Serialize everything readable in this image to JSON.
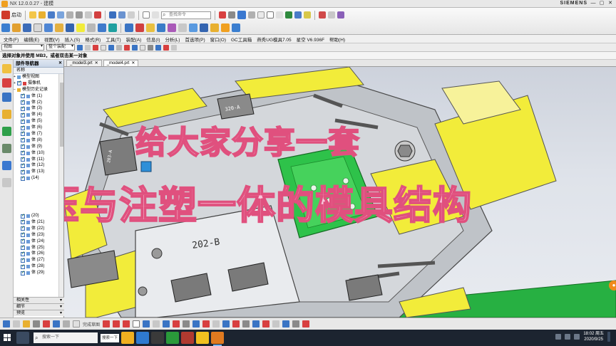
{
  "window": {
    "title": "NX 12.0.0.27 - 建模",
    "brand": "SIEMENS"
  },
  "ribbon": {
    "start_label": "启动",
    "command_search_placeholder": "查找命令"
  },
  "menu": [
    "文件(F)",
    "编辑(E)",
    "视图(V)",
    "插入(S)",
    "格式(R)",
    "工具(T)",
    "装配(A)",
    "信息(I)",
    "分析(L)",
    "首选项(P)",
    "窗口(O)",
    "GC工具箱",
    "燕秀UG模具7.05",
    "星空 V6.936F",
    "帮助(H)"
  ],
  "selection_bar": {
    "filter_value": "视图",
    "scope_value": "整个装配"
  },
  "hint": "选择对象并使用 MB3，或者双击某一对象",
  "navigator": {
    "title": "部件导航器",
    "column_name": "名称",
    "root_items": [
      "模型视图",
      "摄像机",
      "模型历史记录"
    ],
    "bodies": [
      "体 (1)",
      "体 (2)",
      "体 (3)",
      "体 (4)",
      "体 (5)",
      "体 (6)",
      "体 (7)",
      "体 (8)",
      "体 (9)",
      "体 (10)",
      "体 (11)",
      "体 (12)",
      "体 (13)",
      "(14)"
    ],
    "bodies_lower": [
      "(20)",
      "体 (21)",
      "体 (22)",
      "体 (23)",
      "体 (24)",
      "体 (25)",
      "体 (26)",
      "体 (27)",
      "体 (28)",
      "体 (29)"
    ],
    "panels": [
      "相关性",
      "细节",
      "预览"
    ]
  },
  "tabs": [
    {
      "label": "_model3.prt",
      "active": false
    },
    {
      "label": "_model4.prt",
      "active": true
    }
  ],
  "overlay": {
    "line1": "给大家分享一套",
    "line2": "冲压与注塑一体的模具结构"
  },
  "model_labels": {
    "label_320a": "320-A",
    "label_202b": "202-B",
    "label_side": "203-A"
  },
  "bottom_bar": {
    "label": "完成草图"
  },
  "taskbar": {
    "search_placeholder": "搜索一下",
    "input_text": "搜索一下",
    "time": "18:02 周五",
    "date": "2020/9/25"
  },
  "colors": {
    "overlay_fill": "#f8c8dc",
    "overlay_stroke": "#e0507e",
    "model_yellow": "#f2ec3a",
    "model_grey": "#c8c8c8",
    "model_green": "#2ec24a",
    "viewport_bg": "#dfe3ea"
  }
}
